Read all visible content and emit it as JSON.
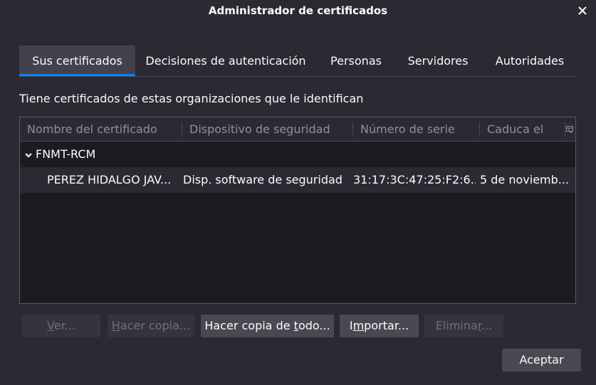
{
  "window": {
    "title": "Administrador de certificados",
    "close_icon": "close-icon"
  },
  "tabs": [
    {
      "label": "Sus certificados",
      "active": true
    },
    {
      "label": "Decisiones de autenticación",
      "active": false
    },
    {
      "label": "Personas",
      "active": false
    },
    {
      "label": "Servidores",
      "active": false
    },
    {
      "label": "Autoridades",
      "active": false
    }
  ],
  "description": "Tiene certificados de estas organizaciones que le identifican",
  "table": {
    "columns": [
      "Nombre del certificado",
      "Dispositivo de seguridad",
      "Número de serie",
      "Caduca el"
    ],
    "column_picker_icon": "column-picker-icon",
    "groups": [
      {
        "name": "FNMT-RCM",
        "expanded": true,
        "rows": [
          {
            "name": "PEREZ HIDALGO JAV...",
            "device": "Disp. software de seguridad",
            "serial": "31:17:3C:47:25:F2:6...",
            "expires": "5 de noviemb..."
          }
        ]
      }
    ]
  },
  "buttons": {
    "view": {
      "pre": "",
      "u": "V",
      "post": "er...",
      "enabled": false
    },
    "backup": {
      "pre": "",
      "u": "H",
      "post": "acer copia...",
      "enabled": false
    },
    "backup_all": {
      "pre": "Hacer copia de ",
      "u": "t",
      "post": "odo...",
      "enabled": true
    },
    "import": {
      "pre": "I",
      "u": "m",
      "post": "portar...",
      "enabled": true
    },
    "delete": {
      "pre": "Elimina",
      "u": "r",
      "post": "...",
      "enabled": false
    },
    "ok": {
      "label": "Aceptar",
      "enabled": true
    }
  },
  "colors": {
    "background": "#2b2a33",
    "accent": "#0a84ff",
    "tree_background": "#1c1b22"
  }
}
